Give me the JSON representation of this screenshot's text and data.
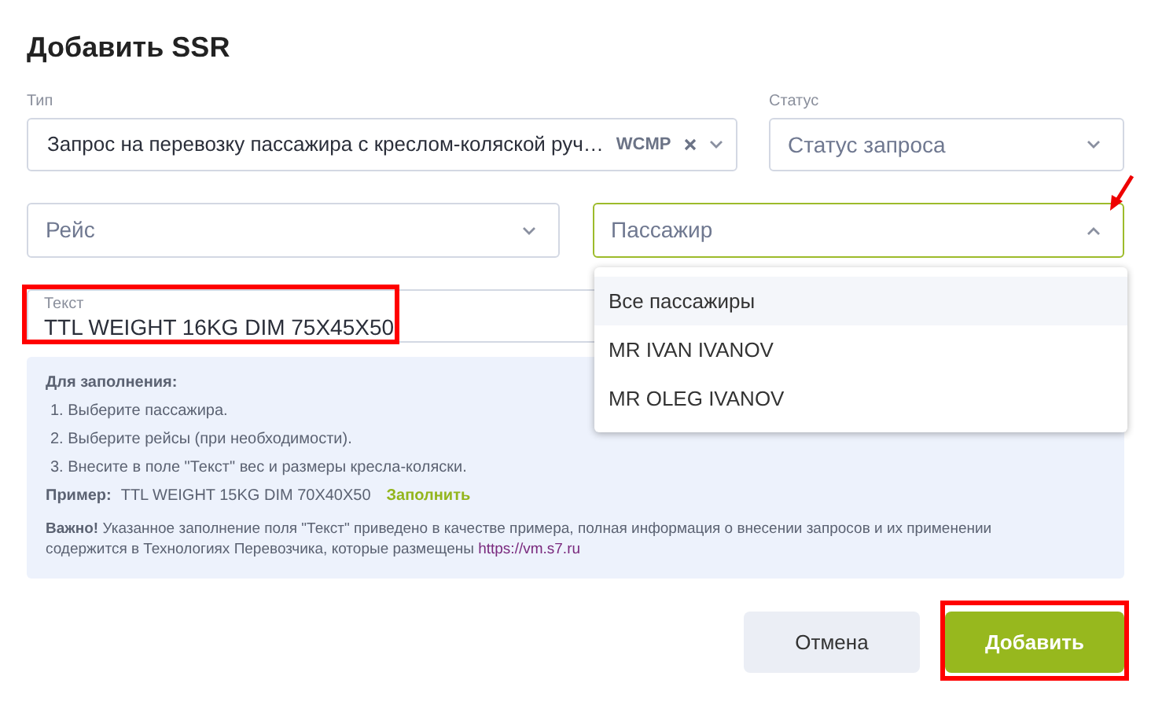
{
  "title": "Добавить SSR",
  "type_field": {
    "label": "Тип",
    "value": "Запрос на перевозку пассажира с креслом-коляской руч…",
    "code": "WCMP"
  },
  "status_field": {
    "label": "Статус",
    "placeholder": "Статус запроса"
  },
  "flight_field": {
    "placeholder": "Рейс"
  },
  "passenger_field": {
    "placeholder": "Пассажир",
    "expanded": true,
    "annotated": true,
    "options": [
      {
        "label": "Все пассажиры",
        "selected": true
      },
      {
        "label": "MR IVAN IVANOV",
        "selected": false
      },
      {
        "label": "MR OLEG IVANOV",
        "selected": false
      }
    ]
  },
  "text_field": {
    "label": "Текст",
    "value": "TTL WEIGHT 16KG DIM 75X45X50",
    "annotated": true
  },
  "info": {
    "heading": "Для заполнения:",
    "steps": [
      "1. Выберите пассажира.",
      "2. Выберите рейсы (при необходимости).",
      "3. Внесите в поле \"Текст\" вес и размеры кресла-коляски."
    ],
    "example_label": "Пример:",
    "example": "TTL WEIGHT 15KG DIM 70X40X50",
    "fill_link": "Заполнить",
    "note": "**Важно!** Указанное заполнение поля \"Текст\" приведено в качестве примера, полная информация о внесении запросов и их применении содержится в Технологиях Перевозчика, которые размещены",
    "note_link": "https://vm.s7.ru"
  },
  "buttons": [
    {
      "label": "Отмена",
      "kind": "secondary",
      "annotated": false
    },
    {
      "label": "Добавить",
      "kind": "primary",
      "annotated": true
    }
  ]
}
